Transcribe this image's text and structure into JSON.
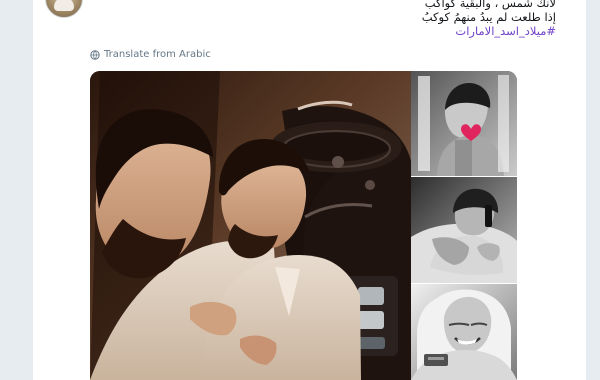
{
  "tweet": {
    "lines": [
      "لانك شمس ، والبقية كواكب",
      "إذا طلعت لم يبدُ منهمُ كوكبُ",
      "#ميلاد_اسد_الامارات"
    ]
  },
  "translate": {
    "label": "Translate from Arabic",
    "icon": "globe-icon"
  },
  "media": {
    "main_photo_icon": "vintage-photo-main",
    "side_photos_icons": [
      "child-photo-heart",
      "man-phone-photo",
      "smiling-man-photo"
    ],
    "heart_icon": "heart-icon"
  },
  "colors": {
    "background": "#e6ecf0",
    "card": "#ffffff",
    "hashtag": "#6f41c8",
    "text": "#14171a",
    "muted": "#657786",
    "heart": "#e0245e"
  }
}
